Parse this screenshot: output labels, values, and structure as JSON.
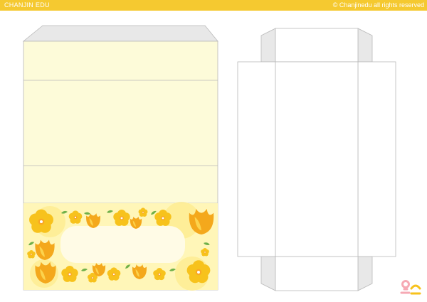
{
  "header": {
    "brand": "CHANJIN EDU",
    "copyright_symbol": "©",
    "copyright_text": "Chanjinedu all rights reserved"
  },
  "colors": {
    "header_yellow": "#f5c930",
    "pocket_cream": "#fdfbd9",
    "flap_gray": "#e8e8e8",
    "outline_gray": "#b9b9b9",
    "flower_yellow": "#f7c21c",
    "flower_orange": "#f4a81c",
    "leaf_green": "#6fb04a",
    "logo_pink": "#f6a9b4",
    "logo_yellow": "#f7c21c"
  },
  "icons": {
    "logo": "chanjin-logo-icon",
    "flower": "flower-icon",
    "tulip": "tulip-icon",
    "leaf": "leaf-icon"
  }
}
